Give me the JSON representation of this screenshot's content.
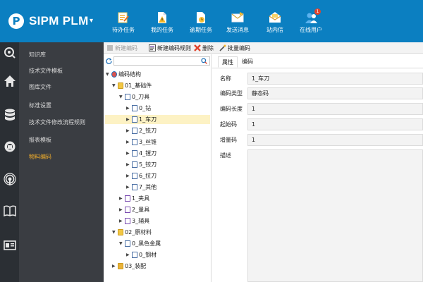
{
  "app": {
    "logo_letter": "P",
    "title": "SIPM PLM",
    "caret": "▾"
  },
  "top_buttons": [
    {
      "label": "待办任务",
      "icon": "task-list-icon"
    },
    {
      "label": "我的任务",
      "icon": "my-task-document-icon"
    },
    {
      "label": "逾期任务",
      "icon": "overdue-task-clock-icon"
    },
    {
      "label": "发送消息",
      "icon": "send-message-envelope-icon"
    },
    {
      "label": "站内信",
      "icon": "inbox-icon"
    },
    {
      "label": "在线用户",
      "icon": "online-users-icon"
    }
  ],
  "top_badge": "1",
  "strip_icons": [
    "search-settings-icon",
    "home-icon",
    "database-icon",
    "support-icon",
    "broadcast-icon",
    "book-icon",
    "id-card-icon"
  ],
  "nav": {
    "items": [
      {
        "label": "知识库"
      },
      {
        "label": "技术文件模板"
      },
      {
        "label": "图库文件"
      },
      {
        "label": "标准设置"
      },
      {
        "label": "技术文件修改流程规则"
      },
      {
        "label": "报表模板"
      },
      {
        "label": "物料编码"
      }
    ],
    "active_index": 6
  },
  "tree_toolbar": {
    "buttons": [
      {
        "label": "新建编码"
      },
      {
        "label": "新建编码规则"
      },
      {
        "label": "删除"
      },
      {
        "label": "批量编码"
      }
    ]
  },
  "tree": {
    "search_placeholder": "",
    "nodes": [
      {
        "label": "编码结构",
        "level": 0,
        "icon": "root",
        "expanded": true
      },
      {
        "label": "01_基础件",
        "level": 1,
        "icon": "folder",
        "expanded": true
      },
      {
        "label": "0_刀具",
        "level": 2,
        "icon": "doc",
        "expanded": true
      },
      {
        "label": "0_钻",
        "level": 3,
        "icon": "doc"
      },
      {
        "label": "1_车刀",
        "level": 3,
        "icon": "doc",
        "selected": true
      },
      {
        "label": "2_铣刀",
        "level": 3,
        "icon": "doc"
      },
      {
        "label": "3_丝锥",
        "level": 3,
        "icon": "doc"
      },
      {
        "label": "4_镗刀",
        "level": 3,
        "icon": "doc"
      },
      {
        "label": "5_铰刀",
        "level": 3,
        "icon": "doc"
      },
      {
        "label": "6_拉刀",
        "level": 3,
        "icon": "doc"
      },
      {
        "label": "7_其他",
        "level": 3,
        "icon": "doc"
      },
      {
        "label": "1_夹具",
        "level": 2,
        "icon": "doc-purple"
      },
      {
        "label": "2_量具",
        "level": 2,
        "icon": "doc-purple"
      },
      {
        "label": "3_辅具",
        "level": 2,
        "icon": "doc-purple"
      },
      {
        "label": "02_原材料",
        "level": 1,
        "icon": "folder",
        "expanded": true
      },
      {
        "label": "0_黑色金属",
        "level": 2,
        "icon": "doc",
        "expanded": true
      },
      {
        "label": "0_钢材",
        "level": 3,
        "icon": "doc"
      },
      {
        "label": "03_装配",
        "level": 1,
        "icon": "folder-assembly"
      }
    ]
  },
  "tabs": [
    {
      "label": "属性",
      "active": true
    },
    {
      "label": "编码"
    }
  ],
  "properties": [
    {
      "label": "名称",
      "value": "1_车刀"
    },
    {
      "label": "编码类型",
      "value": "静态码"
    },
    {
      "label": "编码长度",
      "value": "1"
    },
    {
      "label": "起始码",
      "value": "1"
    },
    {
      "label": "增量码",
      "value": "1"
    },
    {
      "label": "描述",
      "value": ""
    }
  ],
  "colors": {
    "header_bg": "#0b7fc1",
    "nav_bg": "#3a3d42",
    "strip_bg": "#2b2f34",
    "active_nav": "#f0ad2b",
    "delete_red": "#e0442e",
    "selected_row": "#fdf2c4"
  }
}
